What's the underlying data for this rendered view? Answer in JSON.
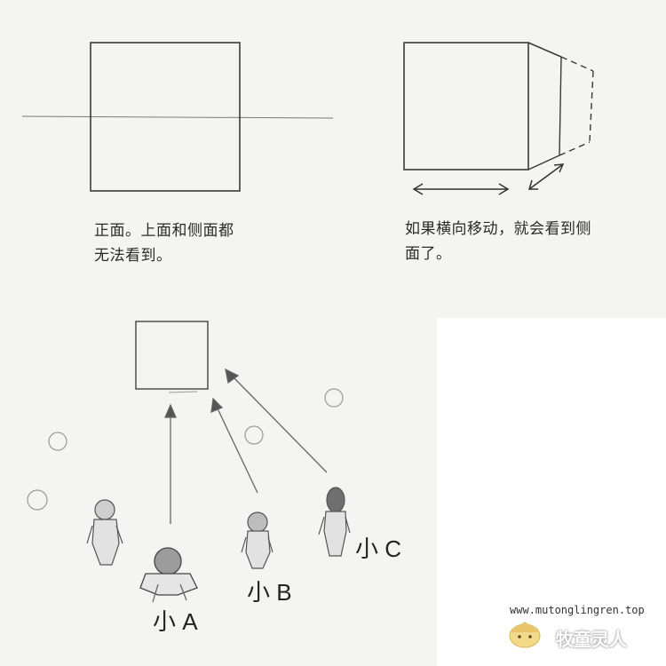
{
  "captions": {
    "front_view": "正面。上面和侧面都\n无法看到。",
    "side_move": "如果横向移动，就会看到侧\n面了。"
  },
  "figures": {
    "a": "小 A",
    "b": "小 B",
    "c": "小 C"
  },
  "watermark": {
    "url": "www.mutonglingren.top",
    "brand": "牧童灵人"
  },
  "colors": {
    "paper": "#f4f4f2",
    "ink": "#2a2a2a",
    "pencil": "#555555"
  }
}
